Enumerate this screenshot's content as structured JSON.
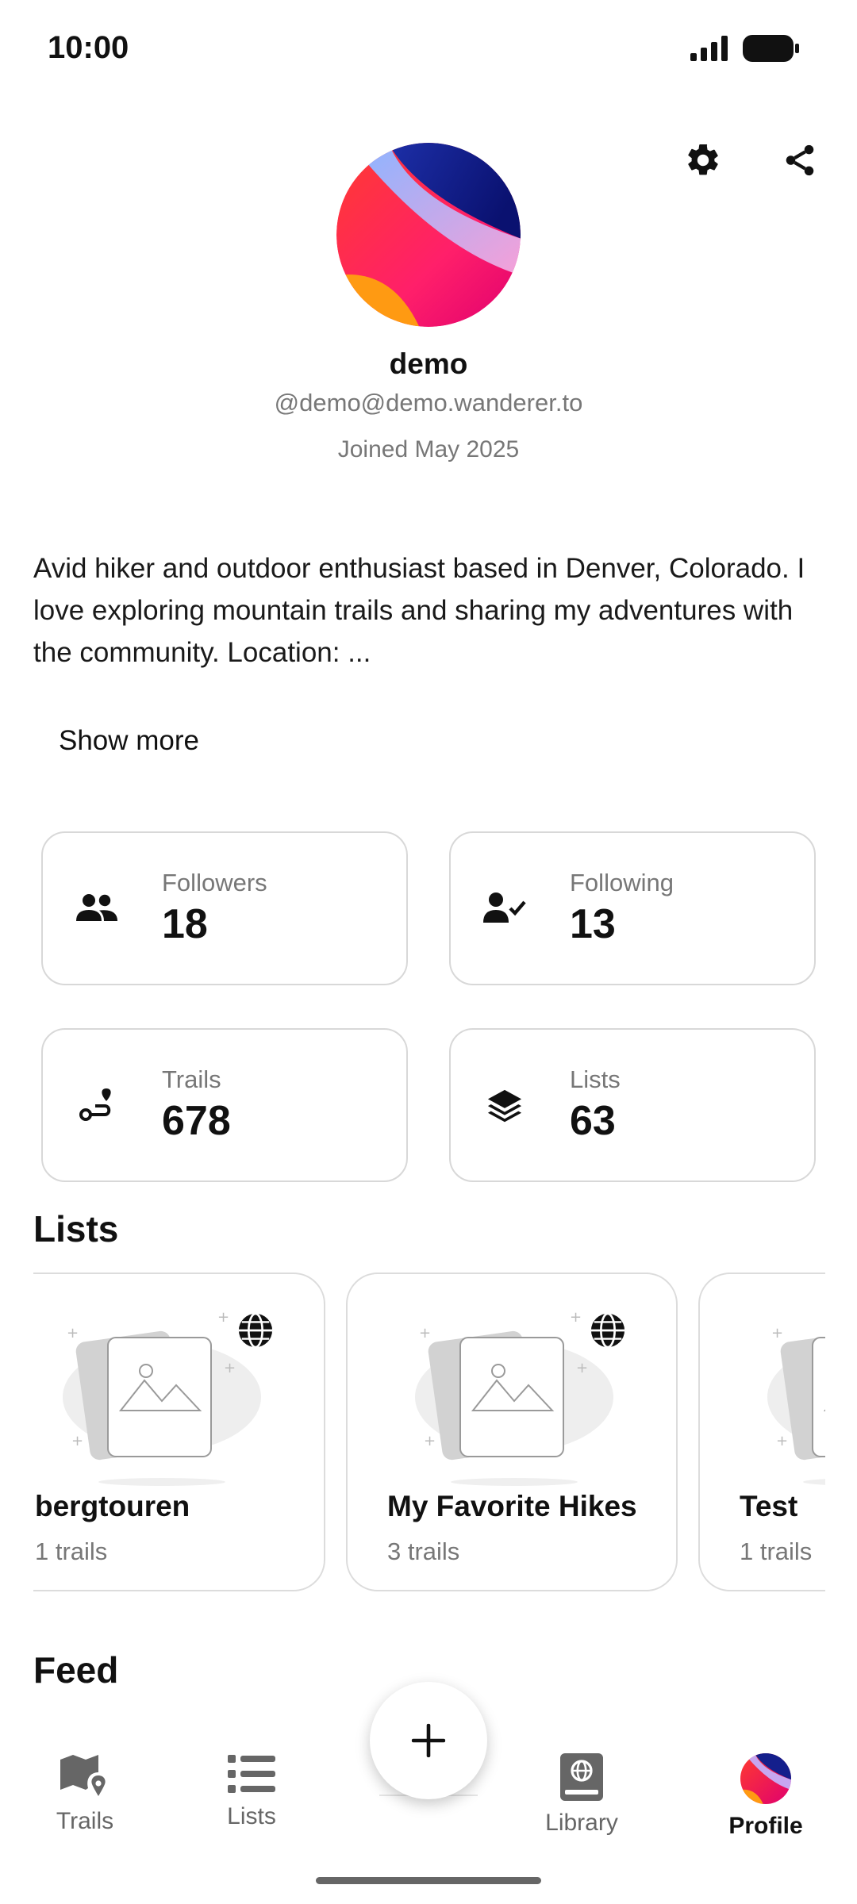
{
  "status_bar": {
    "time": "10:00"
  },
  "profile": {
    "username": "demo",
    "handle": "@demo@demo.wanderer.to",
    "joined": "Joined May 2025",
    "bio": "Avid hiker and outdoor enthusiast based in Denver, Colorado. I love exploring mountain trails and sharing my adventures with the community. Location: ...",
    "show_more": "Show more"
  },
  "stats": [
    {
      "label": "Followers",
      "value": "18",
      "icon": "people-icon"
    },
    {
      "label": "Following",
      "value": "13",
      "icon": "person-check-icon"
    },
    {
      "label": "Trails",
      "value": "678",
      "icon": "route-icon"
    },
    {
      "label": "Lists",
      "value": "63",
      "icon": "layers-icon"
    }
  ],
  "sections": {
    "lists": "Lists",
    "feed": "Feed"
  },
  "lists": [
    {
      "title": "bergtouren",
      "subtitle": "1 trails",
      "visibility_icon": "globe-icon"
    },
    {
      "title": "My Favorite Hikes",
      "subtitle": "3 trails",
      "visibility_icon": "globe-icon"
    },
    {
      "title": "Test",
      "subtitle": "1 trails",
      "visibility_icon": "globe-icon"
    }
  ],
  "nav": {
    "trails": "Trails",
    "lists": "Lists",
    "library": "Library",
    "profile": "Profile"
  },
  "colors": {
    "text": "#111111",
    "muted": "#777777",
    "border": "#d8d8d8"
  }
}
